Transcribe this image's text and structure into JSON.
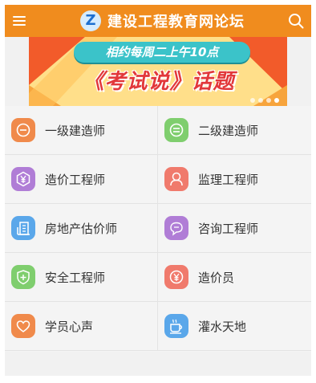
{
  "header": {
    "title": "建设工程教育网论坛",
    "logo_letter": "Z",
    "menu_icon": "menu-icon",
    "search_icon": "search-icon",
    "bg_color": "#f08c1e"
  },
  "banner": {
    "pill_text": "相约每周二上午10点",
    "main_text": "《考试说》话题",
    "page_count": 4
  },
  "grid": {
    "items": [
      {
        "label": "一级建造师",
        "icon": "minus-circle-icon",
        "color": "#f08a4b"
      },
      {
        "label": "二级建造师",
        "icon": "equals-circle-icon",
        "color": "#7fce6e"
      },
      {
        "label": "造价工程师",
        "icon": "yen-hexagon-icon",
        "color": "#b07dd6"
      },
      {
        "label": "监理工程师",
        "icon": "user-icon",
        "color": "#f07a6c"
      },
      {
        "label": "房地产估价师",
        "icon": "building-icon",
        "color": "#5aa7ea"
      },
      {
        "label": "咨询工程师",
        "icon": "chat-bubble-icon",
        "color": "#b07dd6"
      },
      {
        "label": "安全工程师",
        "icon": "shield-plus-icon",
        "color": "#7fce6e"
      },
      {
        "label": "造价员",
        "icon": "yen-circle-icon",
        "color": "#f07a6c"
      },
      {
        "label": "学员心声",
        "icon": "heart-icon",
        "color": "#f08a4b"
      },
      {
        "label": "灌水天地",
        "icon": "coffee-cup-icon",
        "color": "#5aa7ea"
      }
    ]
  }
}
